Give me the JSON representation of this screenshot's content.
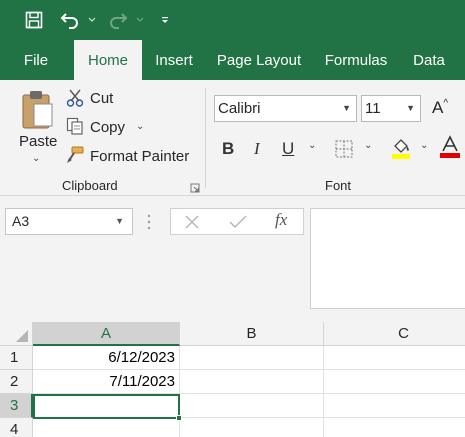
{
  "quick_access": {
    "save_icon": "save-icon",
    "undo_icon": "undo-icon",
    "redo_icon": "redo-icon",
    "customize_icon": "customize-qat-icon"
  },
  "tabs": [
    {
      "label": "File"
    },
    {
      "label": "Home"
    },
    {
      "label": "Insert"
    },
    {
      "label": "Page Layout"
    },
    {
      "label": "Formulas"
    },
    {
      "label": "Data"
    }
  ],
  "clipboard": {
    "paste_label": "Paste",
    "cut_label": "Cut",
    "copy_label": "Copy",
    "format_painter_label": "Format Painter",
    "group_label": "Clipboard"
  },
  "font": {
    "font_name": "Calibri",
    "font_size": "11",
    "bold_label": "B",
    "italic_label": "I",
    "underline_label": "U",
    "increase_font_label": "A",
    "font_color_label": "A",
    "highlight_color": "#ffff00",
    "font_color": "#e00000",
    "group_label": "Font"
  },
  "formula_bar": {
    "name_box": "A3",
    "fx_label": "fx",
    "formula_value": ""
  },
  "grid": {
    "columns": [
      "A",
      "B",
      "C"
    ],
    "rows": [
      "1",
      "2",
      "3",
      "4"
    ],
    "cells": {
      "A1": "6/12/2023",
      "A2": "7/11/2023"
    },
    "active_cell": "A3"
  },
  "colors": {
    "excel_green": "#217346"
  }
}
